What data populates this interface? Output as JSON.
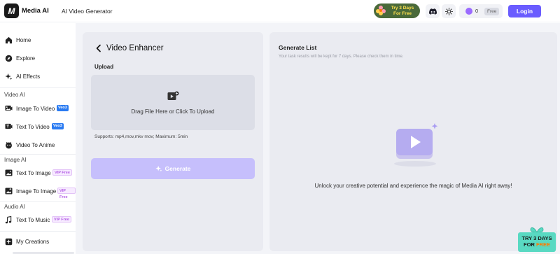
{
  "header": {
    "brand": "Media AI",
    "app_title": "AI Video Generator",
    "promo_line1": "Try 3 Days",
    "promo_line2": "For Free",
    "credits": "0",
    "free_badge": "Free",
    "login_label": "Login"
  },
  "sidebar": {
    "items": [
      {
        "label": "Home",
        "icon": "home-icon"
      },
      {
        "label": "Explore",
        "icon": "compass-icon"
      },
      {
        "label": "AI Effects",
        "icon": "sparkles-icon"
      }
    ],
    "sections": [
      {
        "label": "Video AI",
        "items": [
          {
            "label": "Image To Video",
            "badge": "Veo3"
          },
          {
            "label": "Text To Video",
            "badge": "Veo3"
          },
          {
            "label": "Video To Anime",
            "badge": ""
          }
        ]
      },
      {
        "label": "Image AI",
        "items": [
          {
            "label": "Text To Image",
            "badge": "VIP Free"
          },
          {
            "label": "Image To Image",
            "badge": "VIP Free"
          }
        ]
      },
      {
        "label": "Audio AI",
        "items": [
          {
            "label": "Text To Music",
            "badge": "VIP Free"
          }
        ]
      }
    ],
    "bottom_item": "My Creations"
  },
  "enhancer": {
    "title": "Video Enhancer",
    "upload_label": "Upload",
    "dropzone_text": "Drag File Here or Click To Upload",
    "supports_text": "Supports: mp4,mov,mkv mov; Maximum: 5min",
    "generate_label": "Generate"
  },
  "generate_list": {
    "title": "Generate List",
    "subtitle": "Your task results will be kept for 7 days. Please check them in time.",
    "empty_text": "Unlock your creative potential and experience the magic of Media AI right away!"
  },
  "float_promo": {
    "line1": "TRY 3 DAYS",
    "line2_for": "FOR ",
    "line2_free": "FREE"
  },
  "colors": {
    "accent": "#6a5cff",
    "generate_disabled": "#c6bffc",
    "veo_badge": "#2a7bf2",
    "vip_badge_text": "#b45ee6",
    "panel_bg": "#eaebf1"
  }
}
